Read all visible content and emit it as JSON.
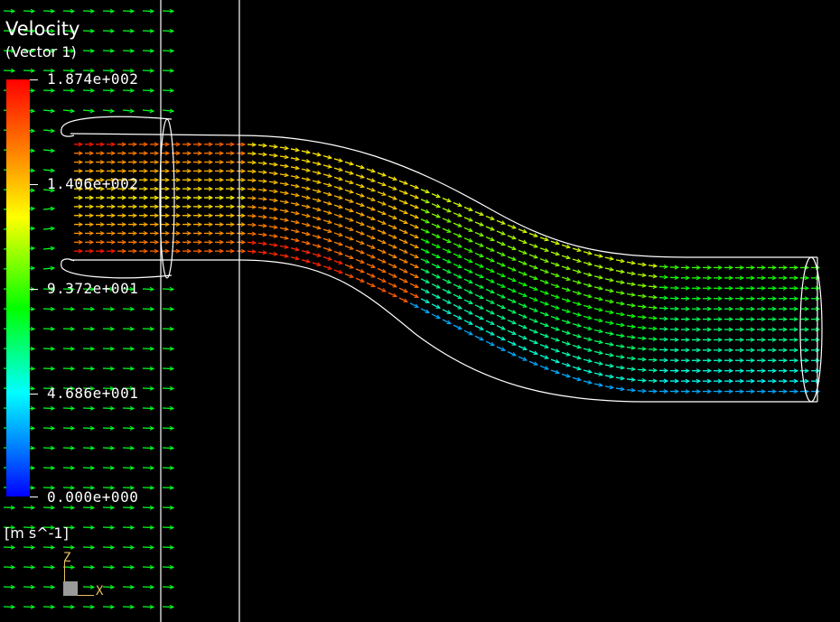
{
  "legend": {
    "title": "Velocity",
    "subtitle": "(Vector 1)",
    "units": "[m s^-1]",
    "ticks": [
      {
        "label": "1.874e+002",
        "value": 187.4
      },
      {
        "label": "1.406e+002",
        "value": 140.6
      },
      {
        "label": "9.372e+001",
        "value": 93.72
      },
      {
        "label": "4.686e+001",
        "value": 46.86
      },
      {
        "label": "0.000e+000",
        "value": 0.0
      }
    ],
    "range": [
      0.0,
      187.4
    ],
    "colormap": [
      "#0000ff",
      "#0080ff",
      "#00ffff",
      "#00ff00",
      "#ffff00",
      "#ff8000",
      "#ff0000"
    ]
  },
  "axes": {
    "z_label": "Z",
    "x_label": "X",
    "axis_color": "#e8c060"
  },
  "scene": {
    "background": "#000000",
    "geometry_color": "#ffffff",
    "vector_field": "velocity vectors through inlet duct and S-bend pipe"
  }
}
